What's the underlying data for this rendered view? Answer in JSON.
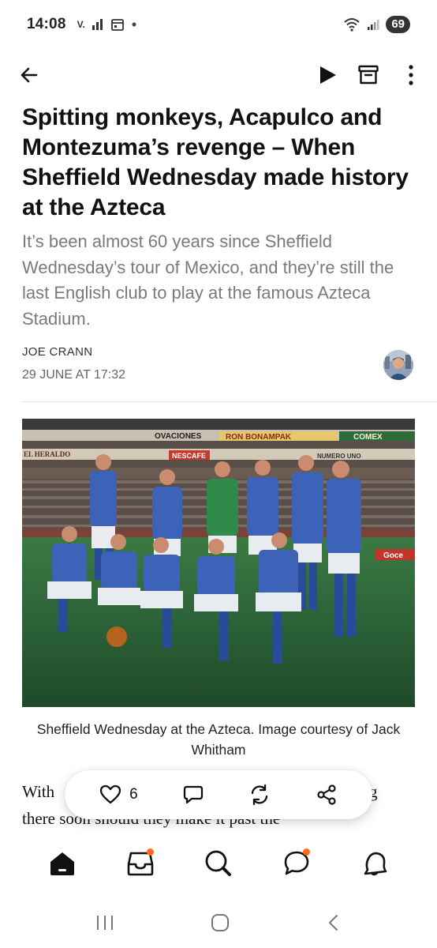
{
  "status_bar": {
    "time": "14:08",
    "carrier_indicator": "V.",
    "battery_level": "69",
    "icons": [
      "signal-bars-icon",
      "calendar-icon",
      "dot-icon",
      "wifi-icon",
      "cell-signal-icon"
    ]
  },
  "toolbar": {
    "icons": [
      "back-arrow-icon",
      "play-icon",
      "archive-icon",
      "more-vertical-icon"
    ]
  },
  "article": {
    "headline": "Spitting monkeys, Acapulco and Montezuma’s revenge – When Sheffield Wednesday made history at the Azteca",
    "dek": "It’s been almost 60 years since Sheffield Wednesday’s tour of Mexico, and they’re still the last English club to play at the famous Azteca Stadium.",
    "author": "JOE CRANN",
    "date": "29 JUNE AT 17:32",
    "image_caption": "Sheffield Wednesday at the Azteca. Image courtesy of Jack Whitham",
    "image_signage": [
      "OVACIONES",
      "RON BONAMPAK",
      "COMEX",
      "EL HERALDO",
      "NESCAFE",
      "NUMERO UNO",
      "Goce"
    ],
    "body_line_1": "With",
    "body_line_2": "there soon should they make it past the",
    "body_line_1_tail": "g"
  },
  "action_bar": {
    "like_count": "6",
    "icons": [
      "heart-icon",
      "comment-icon",
      "restack-icon",
      "share-icon"
    ]
  },
  "bottom_nav": {
    "items": [
      {
        "name": "home",
        "icon": "home-icon",
        "badge": false
      },
      {
        "name": "inbox",
        "icon": "inbox-icon",
        "badge": true
      },
      {
        "name": "search",
        "icon": "search-icon",
        "badge": false
      },
      {
        "name": "chat",
        "icon": "chat-icon",
        "badge": true
      },
      {
        "name": "activity",
        "icon": "bell-icon",
        "badge": false
      }
    ],
    "badge_color": "#ff6a1f"
  },
  "system_nav": {
    "icons": [
      "recents-icon",
      "home-circle-icon",
      "back-chevron-icon"
    ]
  }
}
